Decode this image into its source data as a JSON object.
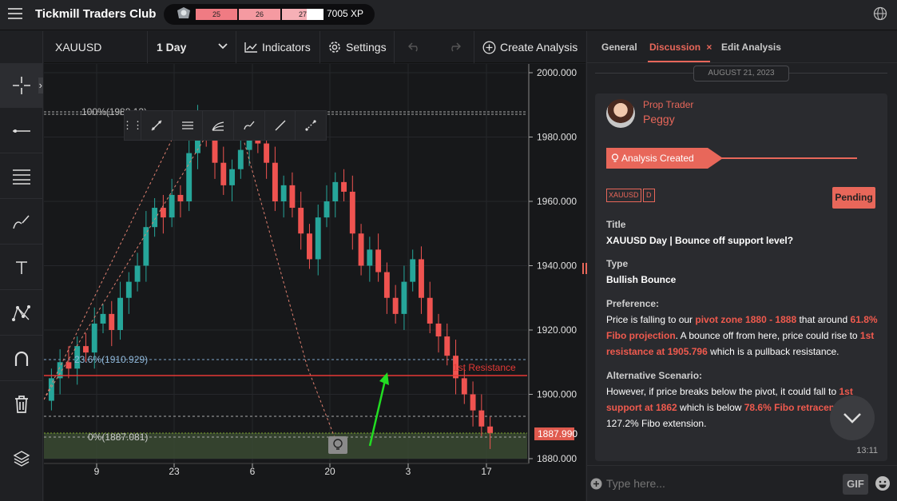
{
  "app": {
    "title": "Tickmill Traders Club",
    "xp_levels": [
      "25",
      "26",
      "27"
    ],
    "xp": "7005 XP"
  },
  "toolbar": {
    "symbol": "XAUUSD",
    "timeframe": "1 Day",
    "indicators": "Indicators",
    "settings": "Settings",
    "create": "Create Analysis"
  },
  "chart": {
    "y_ticks": [
      "2000.000",
      "1980.000",
      "1960.000",
      "1940.000",
      "1920.000",
      "1900.000",
      "1880.000"
    ],
    "x_ticks": [
      "9",
      "23",
      "6",
      "20",
      "3",
      "17"
    ],
    "fib_100": "100%(1988.13)",
    "fib_236": "23.6%(1910.929)",
    "fib_0": "0%(1887.081)",
    "resistance_label": "1st Resistance",
    "price_tag": "1887.990",
    "colors": {
      "up": "#26a69a",
      "down": "#ef5350",
      "resistance": "#e53935"
    }
  },
  "panel": {
    "tabs": [
      "General",
      "Discussion",
      "Edit Analysis"
    ],
    "date": "AUGUST 21, 2023",
    "role": "Prop Trader",
    "name": "Peggy",
    "status_banner": "Analysis Created",
    "tags": [
      "XAUUSD",
      "D"
    ],
    "badge": "Pending",
    "title_label": "Title",
    "title_value": "XAUUSD Day | Bounce off support level?",
    "type_label": "Type",
    "type_value": "Bullish Bounce",
    "pref_label": "Preference:",
    "pref_p1": "Price is falling to our ",
    "pref_h1": "pivot zone 1880 - 1888",
    "pref_p2": " that around ",
    "pref_h2": "61.8% Fibo projection",
    "pref_p3": ". A bounce off from here, price could rise to ",
    "pref_h3": "1st resistance at 1905.796",
    "pref_p4": " which is a pullback resistance.",
    "alt_label": "Alternative Scenario:",
    "alt_p1": "However, if price breaks below the pivot, it could fall to ",
    "alt_h1": "1st support at 1862",
    "alt_p2": " which is below ",
    "alt_h2": "78.6% Fibo retracem",
    "alt_p3": "127.2% Fibo extension.",
    "time": "13:11",
    "input_placeholder": "Type here...",
    "gif": "GIF"
  }
}
